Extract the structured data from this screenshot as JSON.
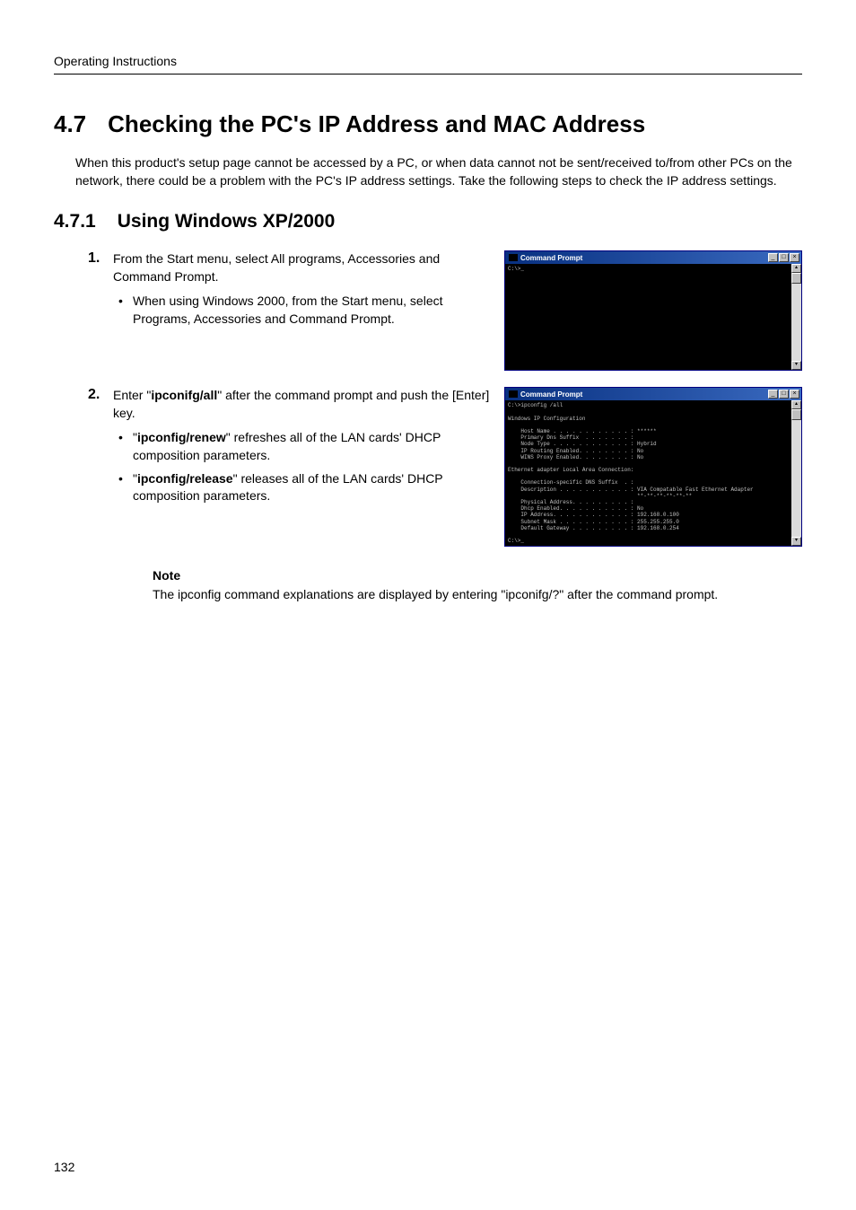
{
  "header": {
    "title": "Operating Instructions"
  },
  "section": {
    "number": "4.7",
    "title": "Checking the PC's IP Address and MAC Address",
    "intro": "When this product's setup page cannot be accessed by a PC, or when data cannot not be sent/received to/from other PCs on the network, there could be a problem with the PC's IP address settings. Take the following steps to check the IP address settings."
  },
  "subsection": {
    "number": "4.7.1",
    "title": "Using Windows XP/2000"
  },
  "steps": [
    {
      "num": "1.",
      "text": "From the Start menu, select All programs, Accessories and Command Prompt.",
      "bullets": [
        {
          "pre": "",
          "bold": "",
          "post": "When using Windows 2000, from the Start menu, select Programs, Accessories and Command Prompt."
        }
      ]
    },
    {
      "num": "2.",
      "text_pre": "Enter \"",
      "text_bold": "ipconifg/all",
      "text_post": "\" after the command prompt and push the [Enter] key.",
      "bullets": [
        {
          "pre": "\"",
          "bold": "ipconfig/renew",
          "post": "\" refreshes all of the LAN cards' DHCP composition parameters."
        },
        {
          "pre": "\"",
          "bold": "ipconfig/release",
          "post": "\" releases all of the LAN cards' DHCP composition parameters."
        }
      ]
    }
  ],
  "cmdwin": {
    "title": "Command Prompt",
    "prompt_empty": "C:\\>_",
    "output": "C:\\>ipconfig /all\n\nWindows IP Configuration\n\n    Host Name . . . . . . . . . . . . : ******\n    Primary Dns Suffix  . . . . . . . :\n    Node Type . . . . . . . . . . . . : Hybrid\n    IP Routing Enabled. . . . . . . . : No\n    WINS Proxy Enabled. . . . . . . . : No\n\nEthernet adapter Local Area Connection:\n\n    Connection-specific DNS Suffix  . :\n    Description . . . . . . . . . . . : VIA Compatable Fast Ethernet Adapter\n                                        **-**-**-**-**-**\n    Physical Address. . . . . . . . . :\n    Dhcp Enabled. . . . . . . . . . . : No\n    IP Address. . . . . . . . . . . . : 192.168.0.100\n    Subnet Mask . . . . . . . . . . . : 255.255.255.0\n    Default Gateway . . . . . . . . . : 192.168.0.254\n\nC:\\>_"
  },
  "note": {
    "heading": "Note",
    "text": "The ipconfig command explanations are displayed by entering \"ipconifg/?\" after the command prompt."
  },
  "page_number": "132"
}
